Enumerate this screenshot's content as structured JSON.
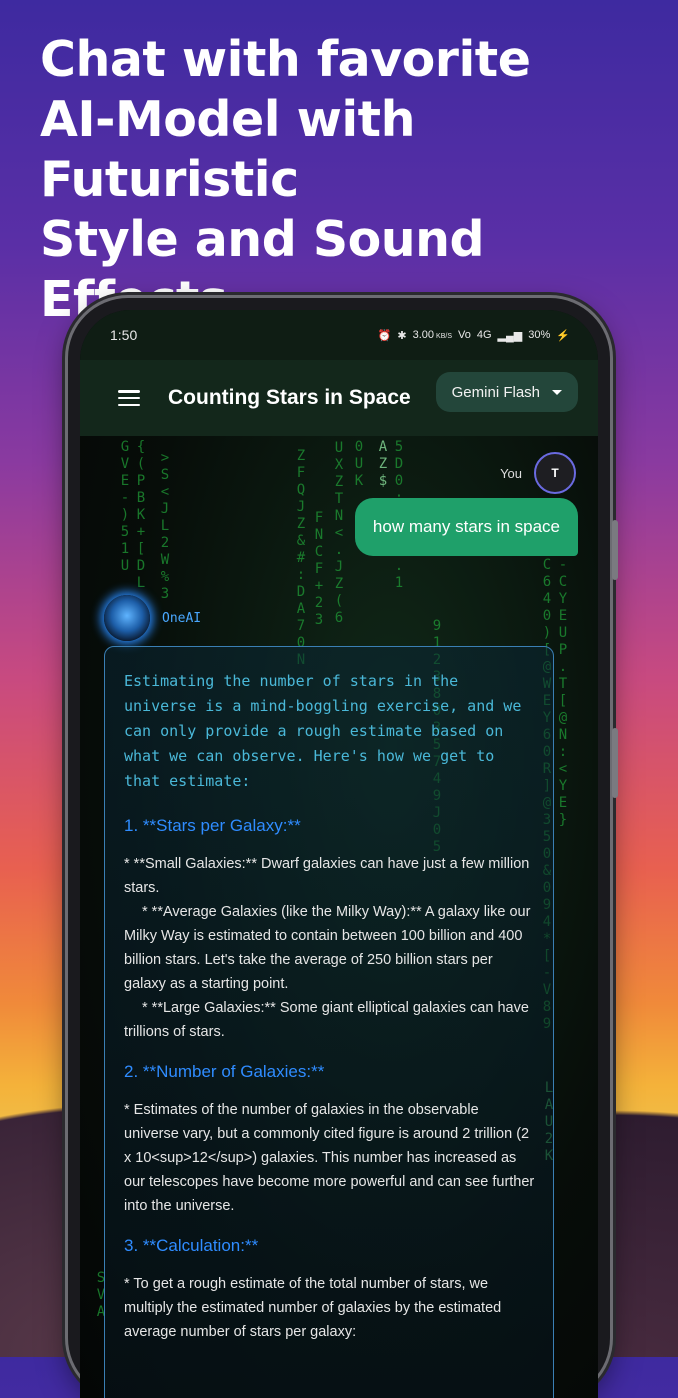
{
  "headline": {
    "line1": "Chat with favorite",
    "line2": "AI-Model with Futuristic",
    "line3": "Style and Sound Effects"
  },
  "status": {
    "time": "1:50",
    "speed": "3.00",
    "speed_unit": "KB/S",
    "network": "4G",
    "battery": "30%"
  },
  "appbar": {
    "title": "Counting Stars in Space",
    "model": "Gemini Flash"
  },
  "chat": {
    "user_label": "You",
    "user_initial": "T",
    "user_message": "how many stars in space",
    "ai_name": "OneAI",
    "intro": "Estimating the number of stars in the universe is a mind-boggling exercise, and we can only provide a rough estimate based on what we can observe. Here's how we get to that estimate:",
    "h1": "1. **Stars per Galaxy:**",
    "p1a": "* **Small Galaxies:** Dwarf galaxies can have just a few million stars.",
    "p1b": "* **Average Galaxies (like the Milky Way):** A galaxy like our Milky Way is estimated to contain between 100 billion and 400 billion stars. Let's take the average of 250 billion stars per galaxy as a starting point.",
    "p1c": "* **Large Galaxies:** Some giant elliptical galaxies can have trillions of stars.",
    "h2": "2. **Number of Galaxies:**",
    "p2": "* Estimates of the number of galaxies in the observable universe vary, but a commonly cited figure is around 2 trillion (2 x 10<sup>12</sup>) galaxies. This number has increased as our telescopes have become more powerful and can see further into the universe.",
    "h3": "3. **Calculation:**",
    "p3": "* To get a rough estimate of the total number of stars, we multiply the estimated number of galaxies by the estimated average number of stars per galaxy:"
  },
  "colors": {
    "matrix_green": "#1f9a36",
    "user_bubble": "#1fa06a",
    "accent_blue": "#2f8cff"
  }
}
